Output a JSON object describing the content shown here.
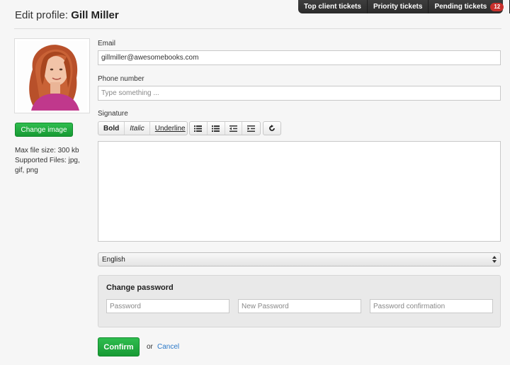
{
  "topbar": {
    "items": [
      {
        "label": "Top client tickets"
      },
      {
        "label": "Priority tickets"
      },
      {
        "label": "Pending tickets",
        "badge": "12"
      }
    ]
  },
  "header": {
    "title_prefix": "Edit profile:",
    "title_name": "Gill Miller"
  },
  "profile": {
    "change_image_label": "Change image",
    "file_info": {
      "max_size": "Max file size: 300 kb",
      "supported": "Supported Files: jpg, gif, png"
    }
  },
  "form": {
    "email_label": "Email",
    "email_value": "gillmiller@awesomebooks.com",
    "phone_label": "Phone number",
    "phone_placeholder": "Type something ...",
    "signature_label": "Signature",
    "editor": {
      "bold": "Bold",
      "italic": "Italic",
      "underline": "Underline"
    },
    "language": {
      "selected": "English"
    },
    "password": {
      "title": "Change password",
      "password_placeholder": "Password",
      "new_password_placeholder": "New Password",
      "confirm_placeholder": "Password confirmation"
    },
    "confirm_label": "Confirm",
    "or_text": "or",
    "cancel_label": "Cancel"
  },
  "colors": {
    "accent_green": "#1fa83d",
    "link_blue": "#2a78c8",
    "badge_red": "#c9302c",
    "topbar_bg": "#333333"
  },
  "icons": [
    "unordered-list-icon",
    "ordered-list-icon",
    "outdent-icon",
    "indent-icon",
    "undo-icon",
    "chevron-down-icon",
    "select-arrows-icon"
  ]
}
